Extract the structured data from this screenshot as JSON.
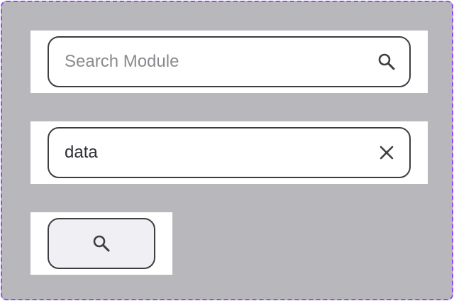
{
  "search_default": {
    "placeholder": "Search Module",
    "icon": "search-icon"
  },
  "search_filled": {
    "value": "data",
    "icon": "close-icon"
  },
  "search_icon_only": {
    "icon": "search-icon"
  },
  "colors": {
    "frame_background": "#b8b8bc",
    "frame_border": "#9747ff",
    "input_border": "#3d3d42",
    "placeholder_text": "#8a8a8f",
    "value_text": "#2f2f33",
    "icon_only_background": "#f0f0f4"
  }
}
